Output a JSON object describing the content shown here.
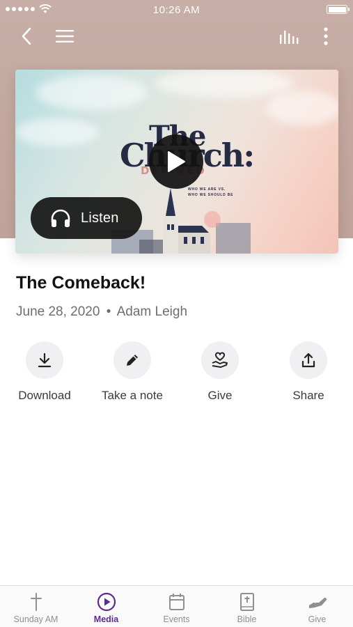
{
  "status_bar": {
    "time": "10:26 AM"
  },
  "artwork": {
    "title_line_1": "The",
    "title_line_2": "Church:",
    "subtitle": "DEFINED",
    "tagline_1": "WHO WE ARE VS.",
    "tagline_2": "WHO WE SHOULD BE"
  },
  "player": {
    "listen_label": "Listen"
  },
  "sermon": {
    "title": "The Comeback!",
    "date": "June 28, 2020",
    "separator": "•",
    "speaker": "Adam Leigh"
  },
  "actions": [
    {
      "label": "Download",
      "icon": "download-icon"
    },
    {
      "label": "Take a note",
      "icon": "pencil-icon"
    },
    {
      "label": "Give",
      "icon": "heart-hand-icon"
    },
    {
      "label": "Share",
      "icon": "share-icon"
    }
  ],
  "tab_bar": {
    "active": "Media",
    "tabs": [
      {
        "label": "Sunday AM",
        "icon": "cross-icon"
      },
      {
        "label": "Media",
        "icon": "play-circle-icon"
      },
      {
        "label": "Events",
        "icon": "calendar-icon"
      },
      {
        "label": "Bible",
        "icon": "bible-icon"
      },
      {
        "label": "Give",
        "icon": "give-hand-icon"
      }
    ]
  },
  "colors": {
    "accent": "#5a2d8c",
    "hero_background": "#c3a79e",
    "button_dark": "#181818",
    "muted_text": "#6d6d72"
  }
}
